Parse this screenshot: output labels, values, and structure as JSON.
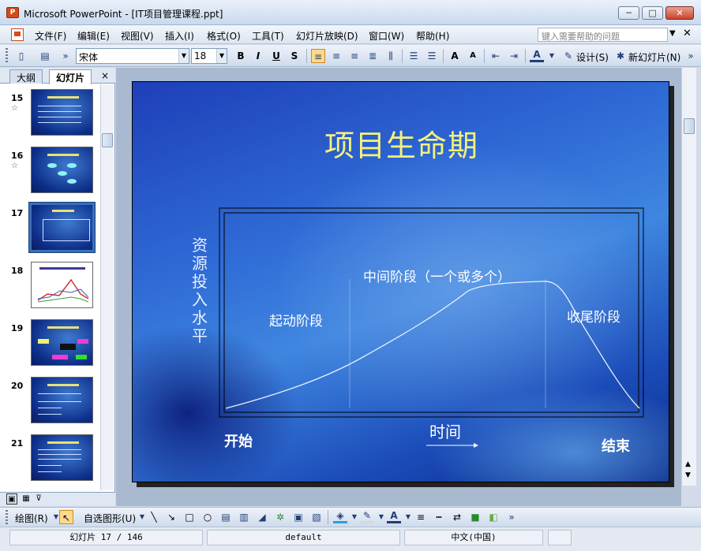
{
  "window": {
    "title": "Microsoft PowerPoint - [IT项目管理课程.ppt]",
    "app_icon_text": "P",
    "min_glyph": "─",
    "max_glyph": "□",
    "close_glyph": "✕"
  },
  "menu": {
    "items": [
      "文件(F)",
      "编辑(E)",
      "视图(V)",
      "插入(I)",
      "格式(O)",
      "工具(T)",
      "幻灯片放映(D)",
      "窗口(W)",
      "帮助(H)"
    ],
    "help_placeholder": "键入需要帮助的问题",
    "doc_close": "✕"
  },
  "toolbar": {
    "font_name": "宋体",
    "font_size": "18",
    "bold": "B",
    "italic": "I",
    "underline": "U",
    "shadow": "S",
    "design_label": "设计(S)",
    "new_slide_label": "新幻灯片(N)"
  },
  "leftpane": {
    "tab_outline": "大纲",
    "tab_slides": "幻灯片",
    "close": "×",
    "thumbnails": [
      {
        "number": "15",
        "star": "☆"
      },
      {
        "number": "16",
        "star": "☆"
      },
      {
        "number": "17",
        "star": ""
      },
      {
        "number": "18",
        "star": ""
      },
      {
        "number": "19",
        "star": ""
      },
      {
        "number": "20",
        "star": ""
      },
      {
        "number": "21",
        "star": ""
      }
    ]
  },
  "slide": {
    "title": "项目生命期",
    "y_axis_label": "资源投入水平",
    "x_axis_label": "时间",
    "start_label": "开始",
    "end_label": "结束",
    "phases": [
      "起动阶段",
      "中间阶段（一个或多个）",
      "收尾阶段"
    ]
  },
  "drawbar": {
    "draw_label": "绘图(R)",
    "autoshape_label": "自选图形(U)"
  },
  "status": {
    "slide_counter": "幻灯片 17 / 146",
    "template": "default",
    "language": "中文(中国)"
  },
  "colors": {
    "title_yellow": "#f5f17a",
    "accent_orange": "#d24b1a"
  }
}
